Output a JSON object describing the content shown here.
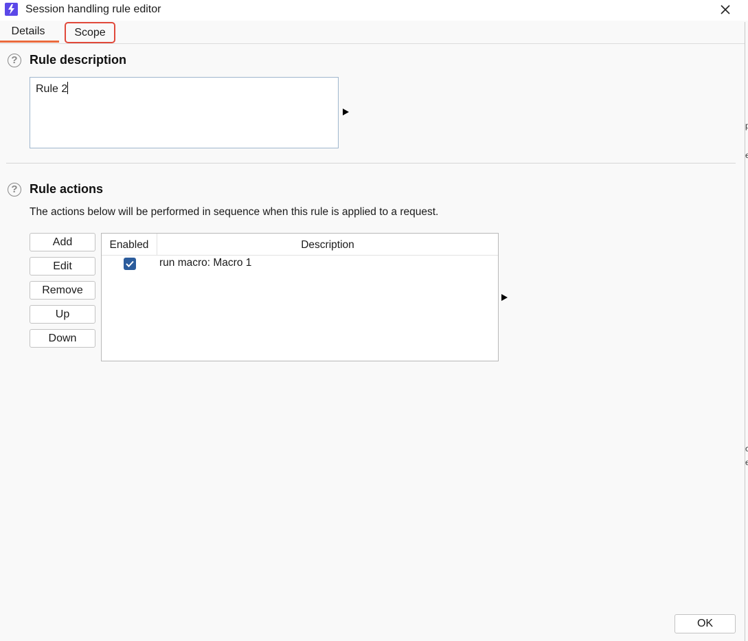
{
  "window": {
    "title": "Session handling rule editor",
    "app_icon": "burp-lightning-icon",
    "close_symbol": "✕",
    "accent_color": "#5b48e8"
  },
  "tabs": [
    {
      "label": "Details",
      "active": true,
      "underline_color": "#ea6a3c"
    },
    {
      "label": "Scope",
      "active": false,
      "highlight_color": "#e0483a"
    }
  ],
  "rule_description": {
    "help_symbol": "?",
    "title": "Rule description",
    "value": "Rule 2"
  },
  "rule_actions": {
    "help_symbol": "?",
    "title": "Rule actions",
    "info": "The actions below will be performed in sequence when this rule is applied to a request.",
    "buttons": [
      "Add",
      "Edit",
      "Remove",
      "Up",
      "Down"
    ],
    "table": {
      "columns": [
        "Enabled",
        "Description"
      ],
      "rows": [
        {
          "enabled": true,
          "description": "run macro: Macro 1"
        }
      ],
      "checkbox_color": "#2b5c9c"
    }
  },
  "footer": {
    "ok_label": "OK"
  },
  "edge_fragments": [
    "p",
    "e",
    "c",
    "e"
  ]
}
